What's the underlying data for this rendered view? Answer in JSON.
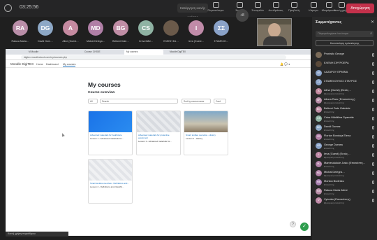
{
  "meeting": {
    "timer": "03:25:56",
    "share_chip": "Κατάργηση κοινής χρήσης",
    "buttons": [
      {
        "label": "Περισσότερα",
        "icon": "more-icon"
      },
      {
        "label": "Άτομα",
        "icon": "people-icon"
      },
      {
        "label": "Συνομιλία",
        "icon": "chat-icon"
      },
      {
        "label": "Αντιδράσεις",
        "icon": "reactions-icon"
      },
      {
        "label": "Προβολή",
        "icon": "view-icon"
      },
      {
        "label": "Κάμερα",
        "icon": "camera-icon"
      },
      {
        "label": "Μικρόφωνο",
        "icon": "microphone-icon"
      },
      {
        "label": "Κοινή χρήση",
        "icon": "share-icon"
      }
    ],
    "leave_label": "Αποχώρηση",
    "leave_color": "#c4314b"
  },
  "participants_strip": [
    {
      "initials": "RA",
      "name": "Ratuca Maria…",
      "color": "#b98ea8"
    },
    {
      "initials": "DG",
      "name": "David Gorn…",
      "color": "#8da8c6"
    },
    {
      "initials": "A",
      "name": "Aline (Guest…",
      "color": "#c58aa0"
    },
    {
      "initials": "MD",
      "name": "Michal Delega…",
      "color": "#b07fa6"
    },
    {
      "initials": "BG",
      "name": "Bellomi Dale…",
      "color": "#c08da5"
    },
    {
      "initials": "CS",
      "name": "Crina Mãd…",
      "color": "#8fb3a3"
    },
    {
      "initials": "",
      "name": "ΕΛΕΝΗ ΣΑ…",
      "color": "#6b5a4a"
    },
    {
      "initials": "I",
      "name": "Ieva (Guest…",
      "color": "#c08ba8"
    },
    {
      "initials": "ΣΣ",
      "name": "ΣΤΑΜΕΛΟ…",
      "color": "#8aa2c8"
    }
  ],
  "strip_more": "+8",
  "browser": {
    "tabs": [
      "Μ Moodle",
      "Course: CIVIDE",
      "My courses",
      "Moodle DigiTEX"
    ],
    "url": "digitex.moodlecloud.com/my/courses.php"
  },
  "moodle": {
    "brand": "Moodle DigiTEX",
    "nav": [
      "Home",
      "Dashboard",
      "My courses"
    ],
    "page_title": "My courses",
    "overview_title": "Course overview",
    "filter_all": "All",
    "search_placeholder": "Search",
    "sort_label": "Sort by course name",
    "view_label": "Card",
    "courses": [
      {
        "category": "Advanced materials for healthcare",
        "title": "Lesson 1 - Advanced materials for…",
        "image": "blue"
      },
      {
        "category": "Advanced materials for protective equipment",
        "title": "Lesson 1 - Advanced materials for…",
        "image": "gray"
      },
      {
        "category": "Smart textiles overview - History",
        "title": "Lesson 1 - History",
        "image": "photo"
      },
      {
        "category": "Smart textiles overview - Definitions and…",
        "title": "Lesson 2 - Definitions and classific…",
        "image": "gray2"
      }
    ],
    "fab_label": "✓",
    "help_label": "?"
  },
  "share_caption": "Κοινή χρήση παραθύρου",
  "panel": {
    "title": "Συμμετέχοντες",
    "close": "✕",
    "search_placeholder": "Πληκτρολογήστε ένα όνομα",
    "invite_label": "Κοινοποίηση πρόσκλησης",
    "people": [
      {
        "initials": "",
        "name": "Pronistic George",
        "role": "",
        "color": "#7a6a58"
      },
      {
        "initials": "",
        "name": "ΕΛΕΝΗ ΣΦΥΡΟΕΡΑ",
        "role": "",
        "color": "#5b4a3a"
      },
      {
        "initials": "ΛΕ",
        "name": "ΛΑΖΑΡΟΥ ΕΡΜΙΝΑ",
        "role": "",
        "color": "#8aa2c8"
      },
      {
        "initials": "ΣΣ",
        "name": "ΣΤΑΜΕΛΟΥΛΟΣ ΣΤΑΥΡΟΣ",
        "role": "",
        "color": "#8aa2c8"
      },
      {
        "initials": "A",
        "name": "Alina (Guest) (Εκτός…",
        "role": "Εξωτερικός επισκέπτης",
        "color": "#c58aa0"
      },
      {
        "initials": "AR",
        "name": "Aliona Raru (Επισκέπτης)",
        "role": "Εξωτερικός επισκέπτης",
        "color": "#b98ea8"
      },
      {
        "initials": "BG",
        "name": "Bellomi Dale Gabriele",
        "role": "Επισκέπτης",
        "color": "#c08da5"
      },
      {
        "initials": "CS",
        "name": "Crina Mădălina Spanette",
        "role": "Επισκέπτης",
        "color": "#8fb3a3"
      },
      {
        "initials": "DG",
        "name": "David Gomez",
        "role": "Επισκέπτης",
        "color": "#8da8c6"
      },
      {
        "initials": "FB",
        "name": "Florian Bondoja Elena",
        "role": "Επισκέπτης",
        "color": "#b07fa6"
      },
      {
        "initials": "GD",
        "name": "George Durnea",
        "role": "Επισκέπτης",
        "color": "#8aa2c8"
      },
      {
        "initials": "I",
        "name": "Ieva (Guest) (Εκτός…",
        "role": "Εξωτερικός επισκέπτης",
        "color": "#c08ba8"
      },
      {
        "initials": "MJ",
        "name": "Mamesdukule Justo (Επισκέπτη…",
        "role": "Επισκέπτης",
        "color": "#b07fa6"
      },
      {
        "initials": "MD",
        "name": "Michał Delegra…",
        "role": "Εξωτερικός επισκέπτης",
        "color": "#b07fa6"
      },
      {
        "initials": "MB",
        "name": "Monica Budesku",
        "role": "Επισκέπτης",
        "color": "#a87fb0"
      },
      {
        "initials": "RA",
        "name": "Ratuca Maria Alieni",
        "role": "Επισκέπτης",
        "color": "#b98ea8"
      },
      {
        "initials": "V",
        "name": "Vylonka (Επισκέπτης)",
        "role": "Εξωτερικός επισκέπτης",
        "color": "#c08ba8"
      }
    ]
  }
}
